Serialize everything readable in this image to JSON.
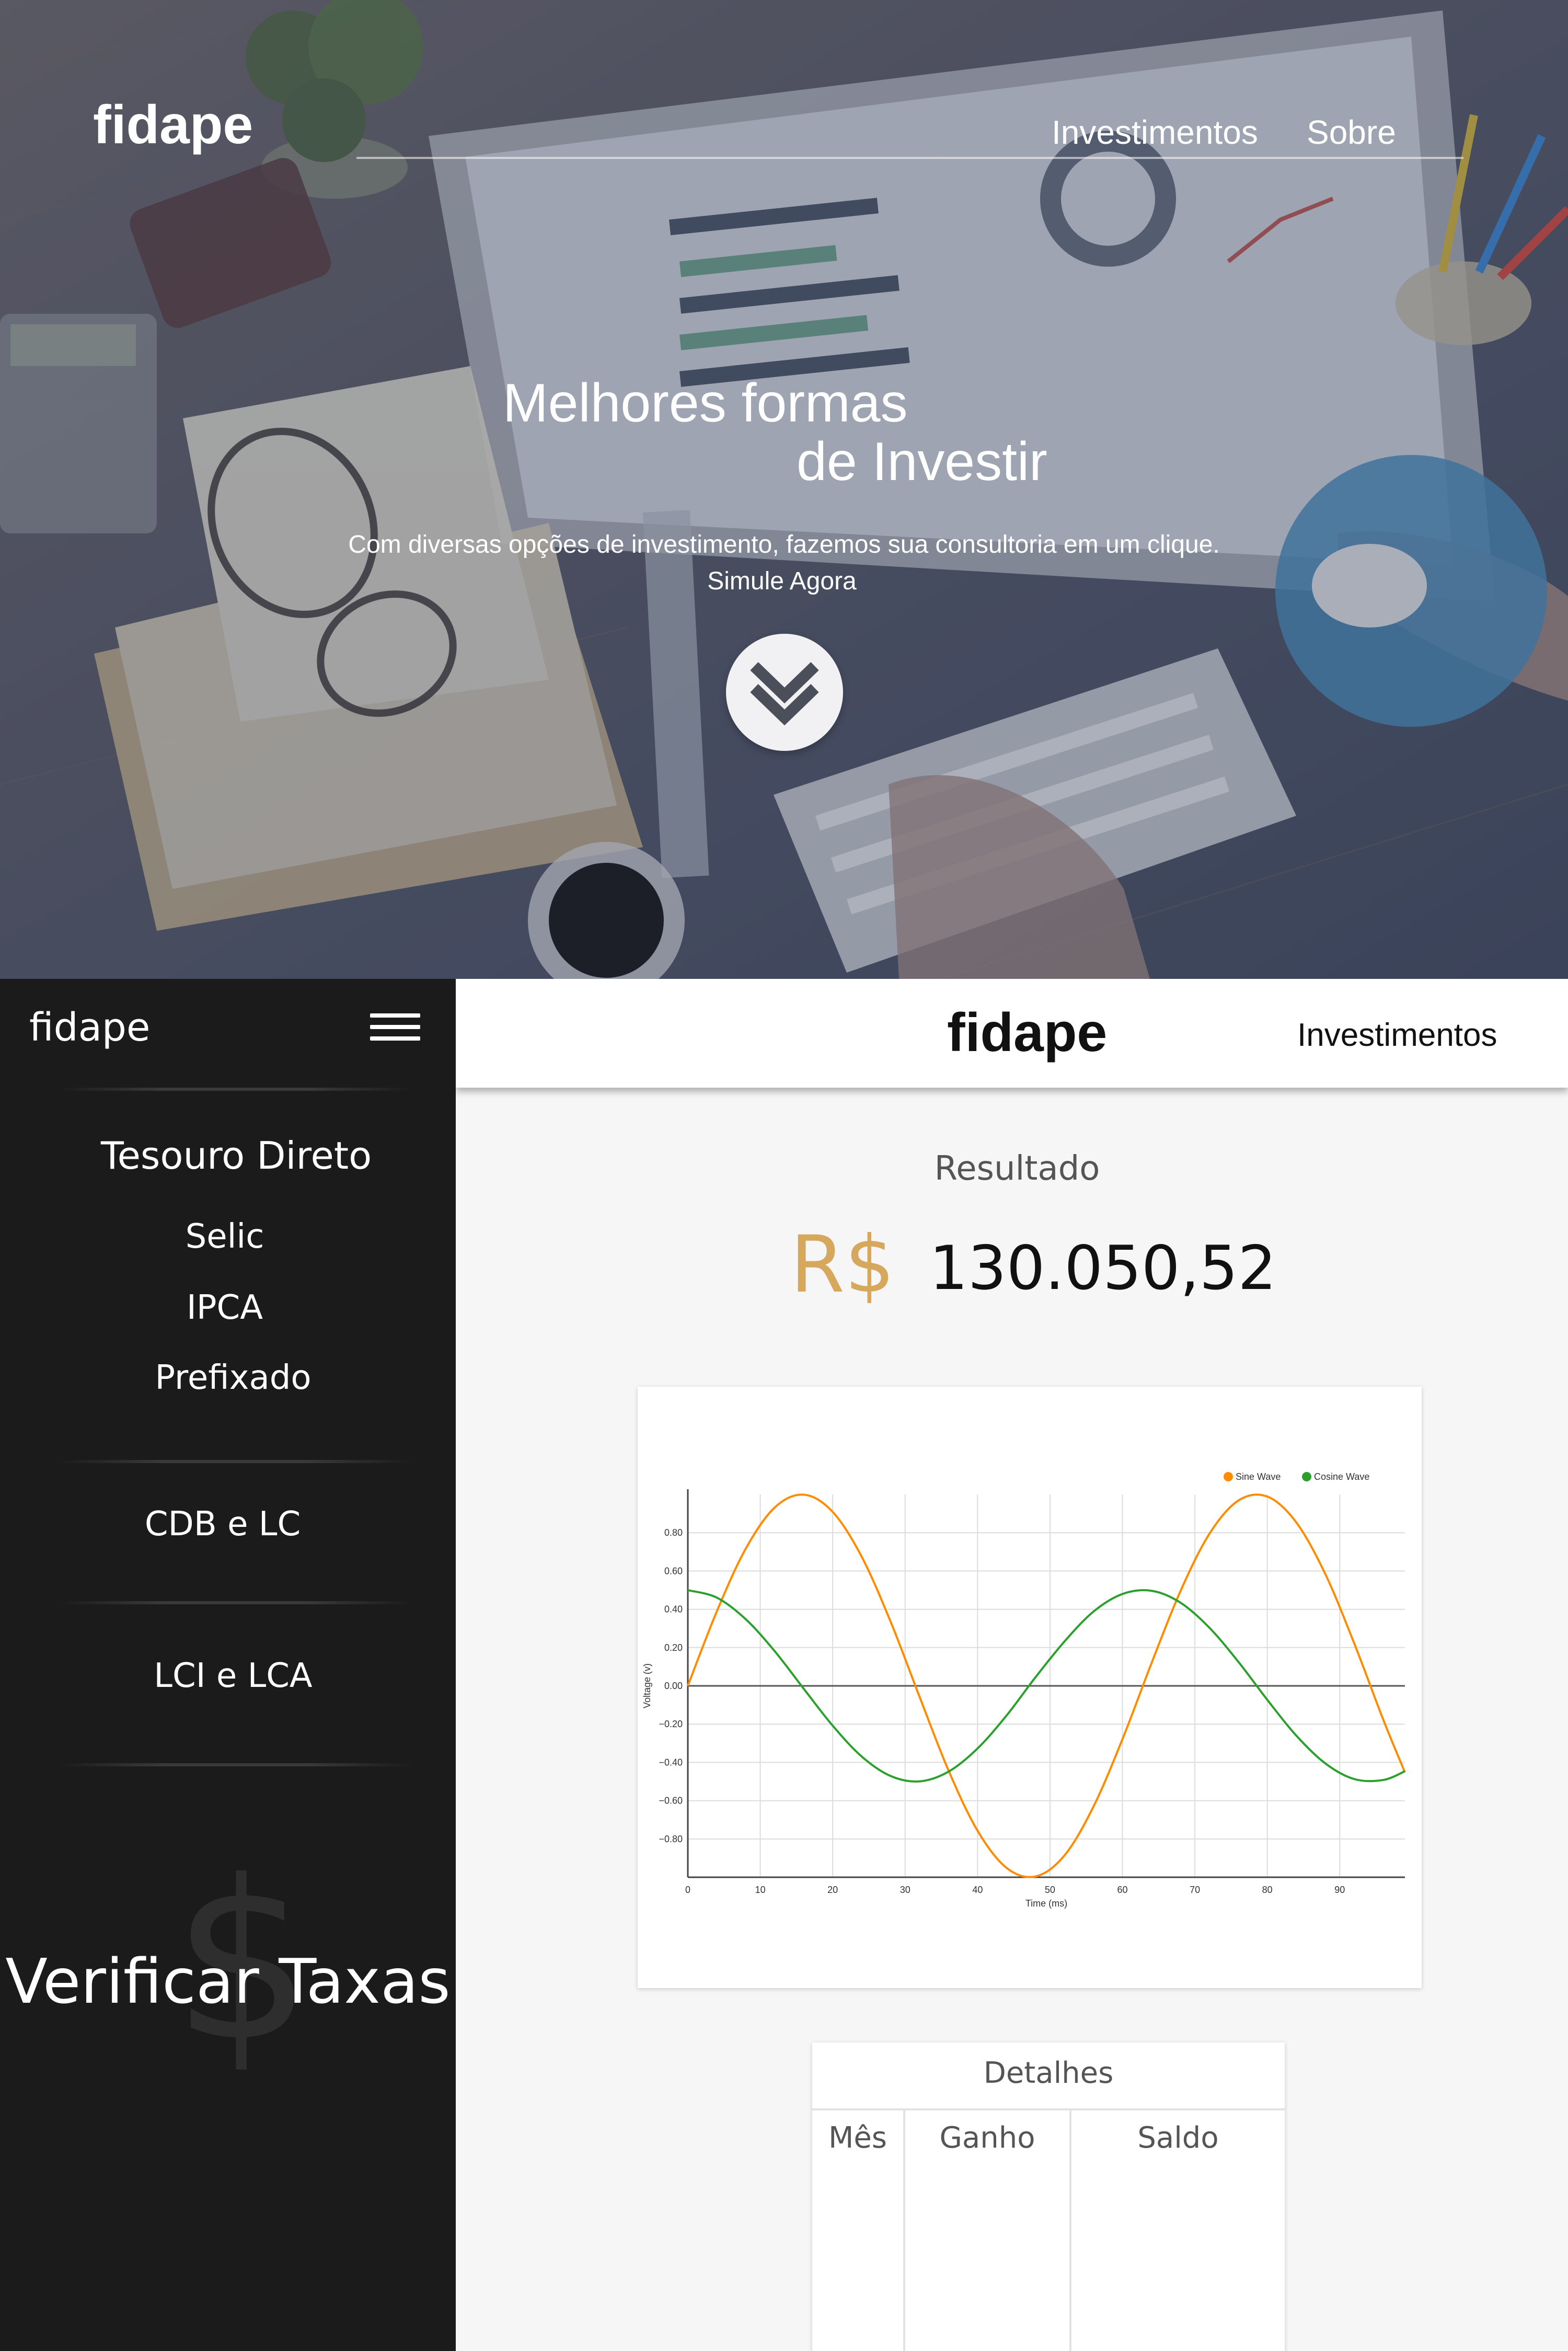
{
  "hero": {
    "logo": "fidape",
    "nav": [
      {
        "label": "Investimentos"
      },
      {
        "label": "Sobre"
      }
    ],
    "title_line1": "Melhores formas",
    "title_line2": "de Investir",
    "subtitle": "Com diversas opções de investimento, fazemos sua consultoria em um clique.",
    "cta": "Simule Agora",
    "scroll_icon": "double-chevron-down-icon"
  },
  "sidebar": {
    "logo": "fidape",
    "menu_icon": "hamburger-icon",
    "group_title": "Tesouro Direto",
    "items": [
      {
        "label": "Selic"
      },
      {
        "label": "IPCA"
      },
      {
        "label": "Prefixado"
      }
    ],
    "cdb": "CDB e LC",
    "lci": "LCI e LCA",
    "verify_label": "Verificar Taxas",
    "verify_icon": "$"
  },
  "topbar": {
    "logo": "fidape",
    "nav": "Investimentos"
  },
  "result": {
    "label": "Resultado",
    "currency": "R$",
    "value": "130.050,52"
  },
  "details": {
    "title": "Detalhes",
    "columns": [
      "Mês",
      "Ganho",
      "Saldo"
    ]
  },
  "colors": {
    "sine": "#ff8c00",
    "cosine": "#2ca02c",
    "accent": "#d6a85e",
    "sidebar_bg": "#1b1b1b"
  },
  "chart_data": {
    "type": "line",
    "title": "",
    "xlabel": "Time (ms)",
    "ylabel": "Voltage (v)",
    "xlim": [
      0,
      99
    ],
    "ylim": [
      -1,
      1
    ],
    "x_ticks": [
      0,
      10,
      20,
      30,
      40,
      50,
      60,
      70,
      80,
      90
    ],
    "y_ticks": [
      -0.8,
      -0.6,
      -0.4,
      -0.2,
      0,
      0.2,
      0.4,
      0.6,
      0.8
    ],
    "y_tick_labels": [
      "−0.80",
      "−0.60",
      "−0.40",
      "−0.20",
      "0.00",
      "0.20",
      "0.40",
      "0.60",
      "0.80"
    ],
    "grid": true,
    "legend_position": "top-right",
    "series": [
      {
        "name": "Sine Wave",
        "color": "#ff8c00",
        "x": [
          0,
          4,
          8,
          12,
          16,
          20,
          24,
          28,
          32,
          36,
          40,
          44,
          48,
          52,
          56,
          60,
          64,
          68,
          72,
          76,
          80,
          84,
          88,
          92,
          96,
          99
        ],
        "y": [
          0,
          0.389,
          0.717,
          0.932,
          0.999,
          0.909,
          0.675,
          0.335,
          -0.058,
          -0.443,
          -0.757,
          -0.951,
          -0.996,
          -0.886,
          -0.631,
          -0.279,
          0.117,
          0.494,
          0.794,
          0.968,
          0.989,
          0.854,
          0.585,
          0.222,
          -0.176,
          -0.452
        ]
      },
      {
        "name": "Cosine Wave",
        "color": "#2ca02c",
        "x": [
          0,
          4,
          8,
          12,
          16,
          20,
          24,
          28,
          32,
          36,
          40,
          44,
          48,
          52,
          56,
          60,
          64,
          68,
          72,
          76,
          80,
          84,
          88,
          92,
          96,
          99
        ],
        "y": [
          0.5,
          0.461,
          0.348,
          0.181,
          -0.015,
          -0.208,
          -0.369,
          -0.471,
          -0.499,
          -0.448,
          -0.327,
          -0.155,
          0.045,
          0.232,
          0.388,
          0.48,
          0.497,
          0.435,
          0.304,
          0.126,
          -0.073,
          -0.26,
          -0.405,
          -0.487,
          -0.492,
          -0.446
        ]
      }
    ]
  }
}
